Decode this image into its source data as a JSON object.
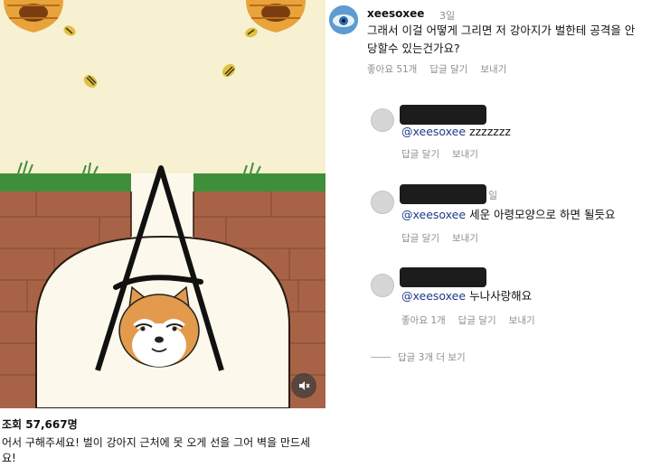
{
  "post": {
    "views_label": "조회 57,667명",
    "caption": "어서 구해주세요! 벌이 강아지 근처에 못 오게 선을 그어 벽을 만드세요!",
    "colors": {
      "sky": "#f7f1d2",
      "grass": "#3f8f3a",
      "soil": "#a86346",
      "burrow": "#fcf9ec"
    }
  },
  "comment": {
    "username": "xeesoxee",
    "time": "3일",
    "text": "그래서 이걸 어떻게 그리면 저 강아지가 벌한테 공격을 안 당할수 있는건가요?",
    "likes": "좋아요 51개",
    "reply_label": "답글 달기",
    "send_label": "보내기"
  },
  "replies": [
    {
      "mention": "@xeesoxee",
      "text": "zzzzzzz",
      "actions": [
        "답글 달기",
        "보내기"
      ]
    },
    {
      "time": "일",
      "mention": "@xeesoxee",
      "text": "세운 아령모양으로 하면 될듯요",
      "actions": [
        "답글 달기",
        "보내기"
      ]
    },
    {
      "mention": "@xeesoxee",
      "text": "누나사랑해요",
      "actions": [
        "좋아요 1개",
        "답글 달기",
        "보내기"
      ]
    }
  ],
  "more_replies": "답글 3개 더 보기"
}
